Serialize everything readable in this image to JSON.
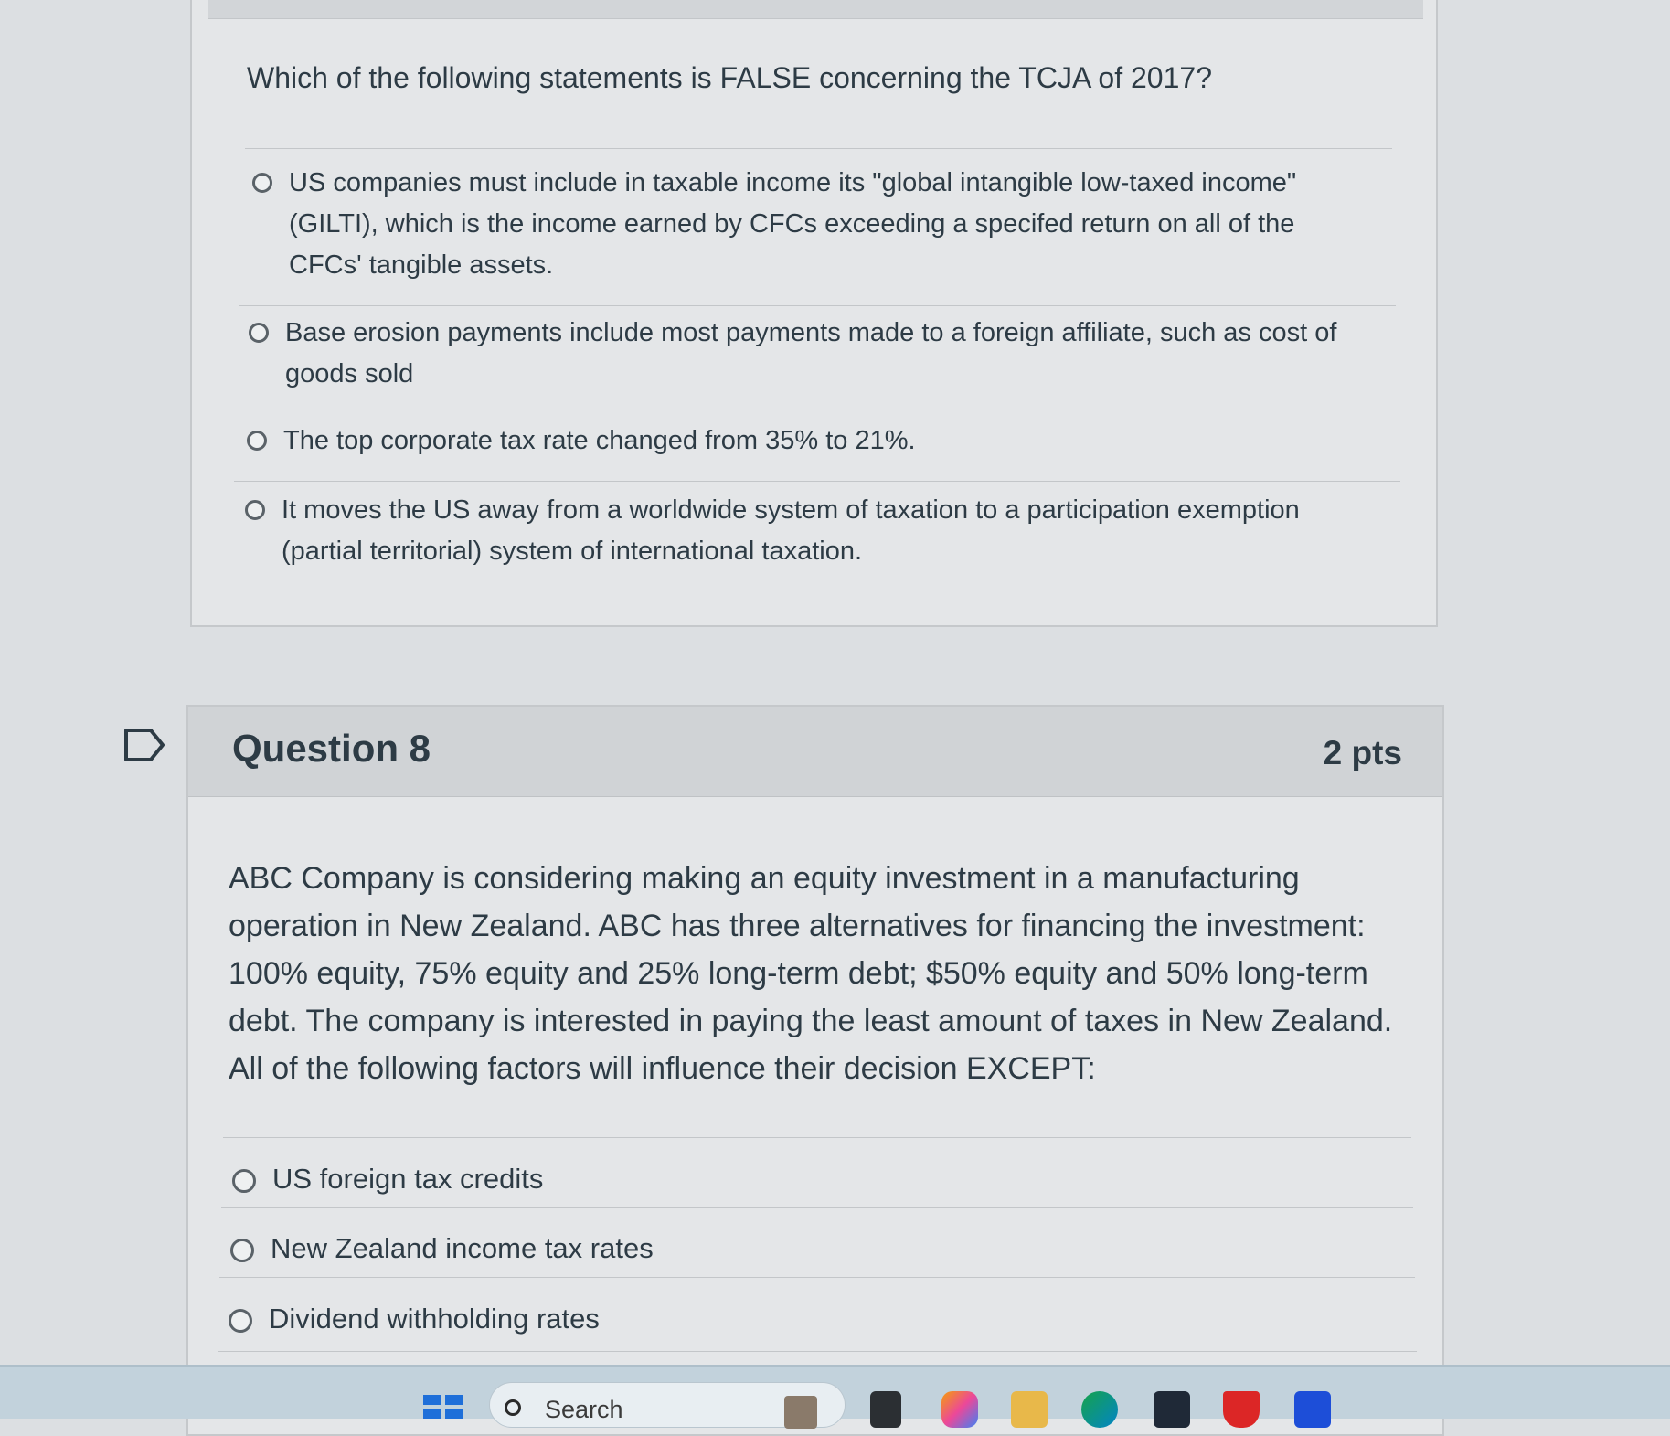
{
  "question7": {
    "text": "Which of the following statements is FALSE concerning the TCJA of 2017?",
    "answers": [
      "US companies must include in taxable income its \"global intangible low-taxed income\" (GILTI), which is the income earned by CFCs exceeding a specifed return on all of the CFCs' tangible assets.",
      "Base erosion payments include most payments made to a foreign affiliate, such as cost of goods sold",
      "The top corporate tax rate changed from 35% to 21%.",
      "It moves the US away from a worldwide system of taxation to a participation exemption (partial territorial) system of international taxation."
    ]
  },
  "question8": {
    "title": "Question 8",
    "points": "2 pts",
    "text": "ABC Company is considering making an equity investment in a manufacturing operation in New Zealand.  ABC has three alternatives for financing the investment: 100% equity, 75% equity and 25% long-term debt; $50% equity and 50% long-term debt. The company is interested in paying the least amount of taxes in New Zealand. All of the following factors will influence their decision EXCEPT:",
    "answers": [
      "US foreign tax credits",
      "New Zealand income tax rates",
      "Dividend withholding rates"
    ]
  },
  "taskbar": {
    "search_label": "Search",
    "icons": [
      "windows-start-icon",
      "search-icon",
      "file-explorer-icon",
      "copilot-icon",
      "folder-icon",
      "edge-icon",
      "store-icon",
      "mcafee-icon",
      "autocad-icon"
    ]
  }
}
